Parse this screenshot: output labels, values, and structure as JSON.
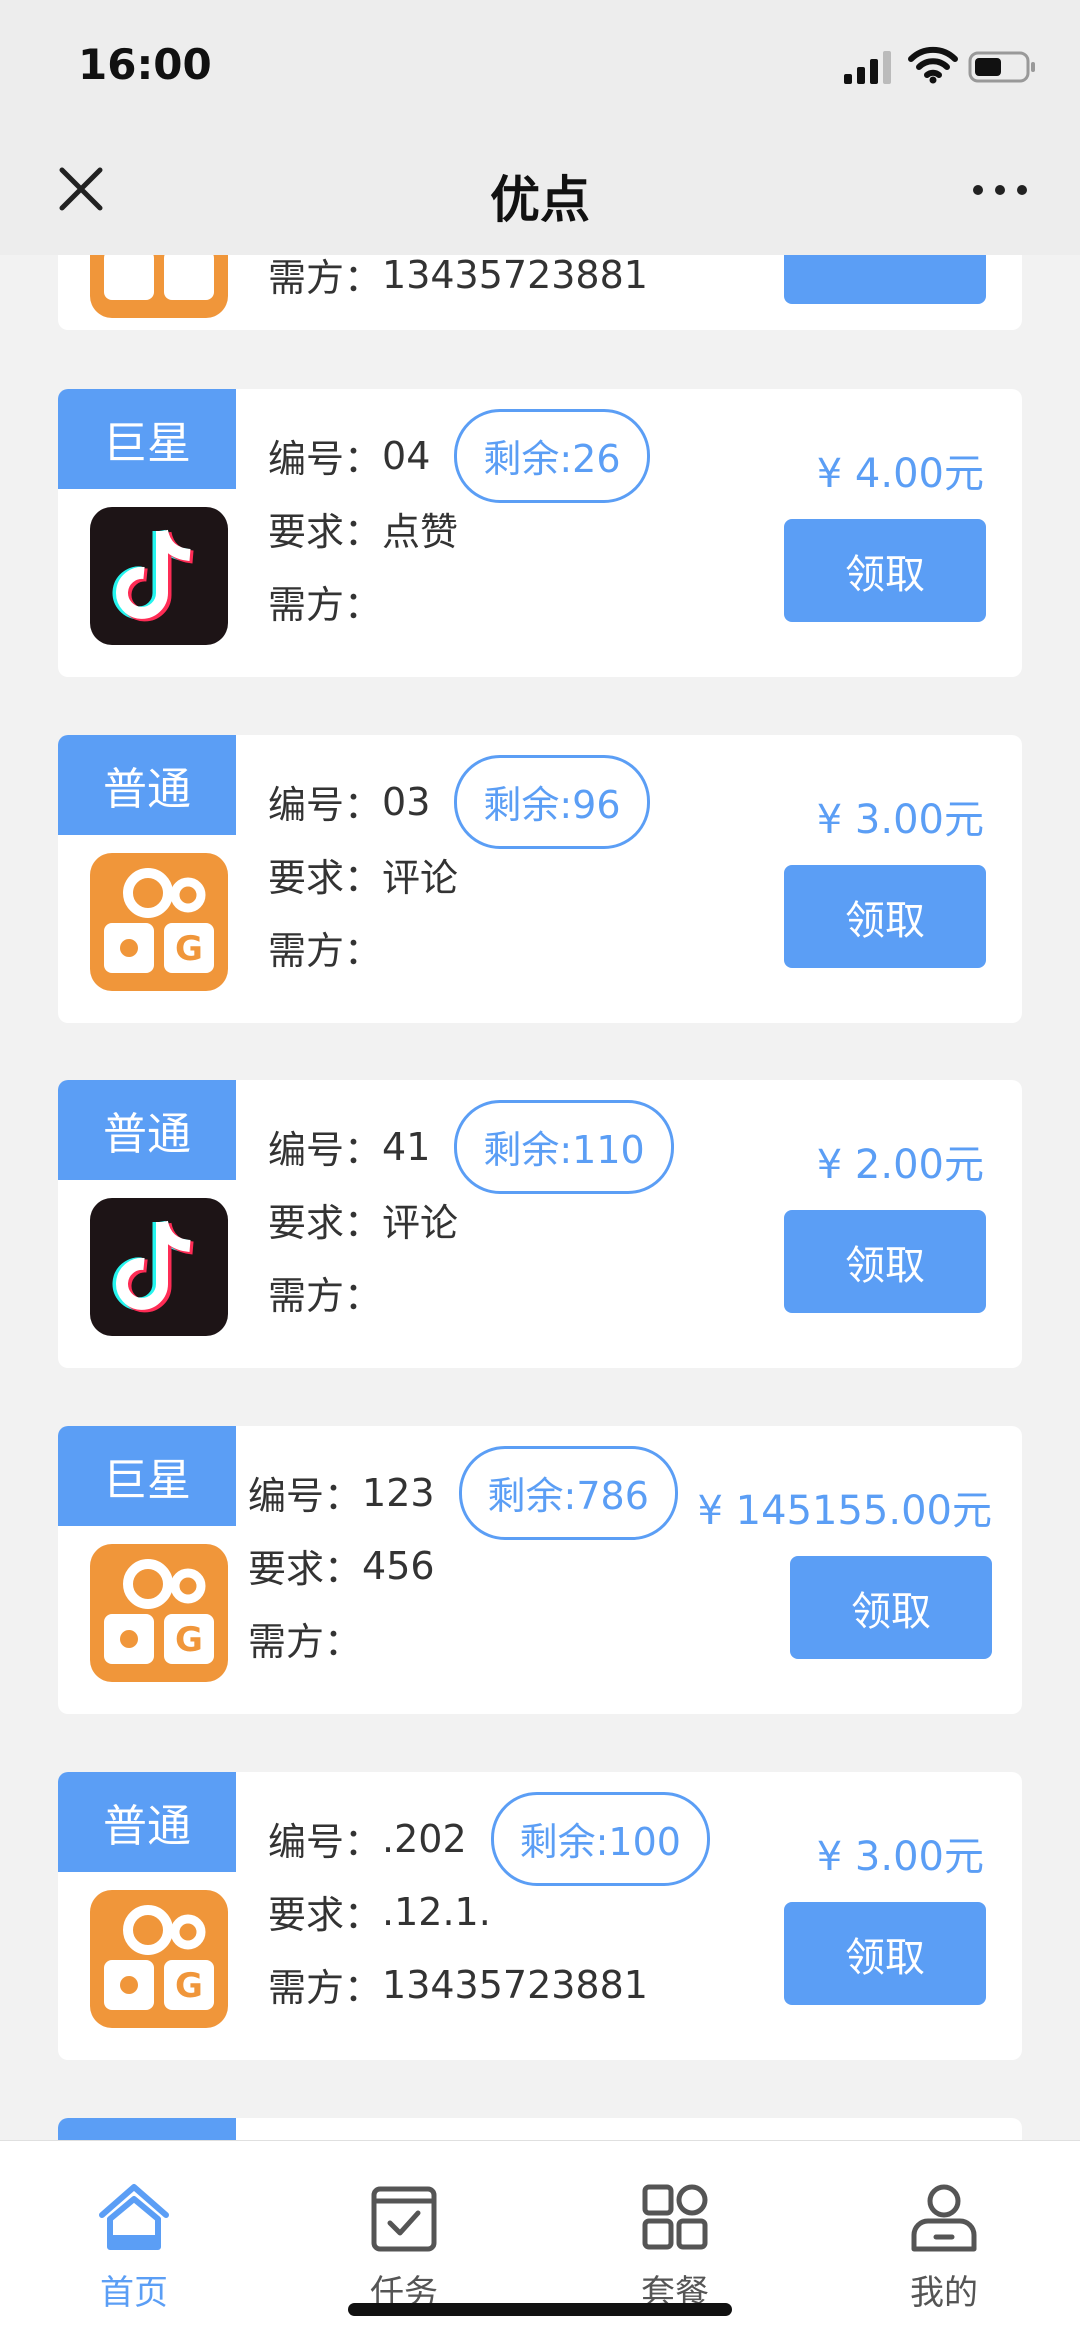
{
  "status": {
    "time": "16:00"
  },
  "nav": {
    "title": "优点"
  },
  "labels": {
    "id": "编号：",
    "req": "要求：",
    "owner": "需方：",
    "claim": "领取"
  },
  "cards": [
    {
      "tag": "",
      "icon": "kuaishou-icon",
      "id": "",
      "remaining": "",
      "req": "",
      "owner": "13435723881",
      "price": "",
      "partial": true
    },
    {
      "tag": "巨星",
      "icon": "tiktok-icon",
      "id": "04",
      "remaining": "剩余:26",
      "req": "点赞",
      "owner": "",
      "price": "¥ 4.00元"
    },
    {
      "tag": "普通",
      "icon": "kuaishou-icon",
      "id": "03",
      "remaining": "剩余:96",
      "req": "评论",
      "owner": "",
      "price": "¥ 3.00元"
    },
    {
      "tag": "普通",
      "icon": "tiktok-icon",
      "id": "41",
      "remaining": "剩余:110",
      "req": "评论",
      "owner": "",
      "price": "¥ 2.00元"
    },
    {
      "tag": "巨星",
      "icon": "kuaishou-icon",
      "id": "123",
      "remaining": "剩余:786",
      "req": "456",
      "owner": "",
      "price": "¥ 145155.00元"
    },
    {
      "tag": "普通",
      "icon": "kuaishou-icon",
      "id": ".202",
      "remaining": "剩余:100",
      "req": ".12.1.",
      "owner": "13435723881",
      "price": "¥ 3.00元"
    }
  ],
  "tabs": [
    {
      "label": "首页",
      "icon": "home-icon",
      "active": true
    },
    {
      "label": "任务",
      "icon": "task-icon",
      "active": false
    },
    {
      "label": "套餐",
      "icon": "grid-icon",
      "active": false
    },
    {
      "label": "我的",
      "icon": "user-icon",
      "active": false
    }
  ],
  "colors": {
    "accent": "#5b9ef5",
    "kuaishou": "#f0963a",
    "tiktok": "#1d1416"
  }
}
